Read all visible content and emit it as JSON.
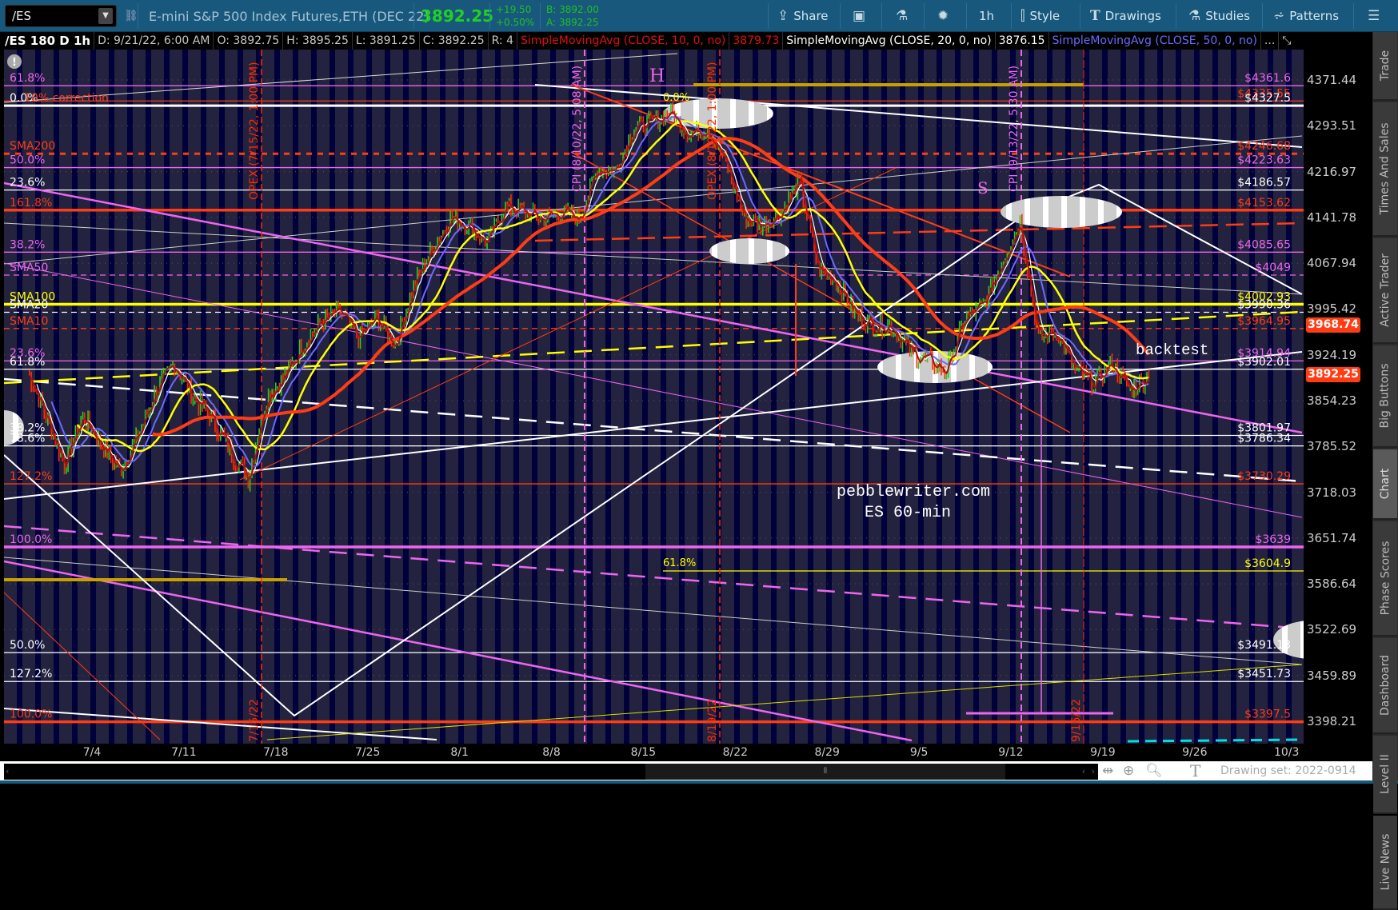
{
  "toolbar": {
    "symbol": "/ES",
    "description": "E-mini S&P 500 Index Futures,ETH (DEC 22)",
    "last": "3892.25",
    "change": "+19.50",
    "change_pct": "+0.50%",
    "bid": "B: 3892.00",
    "ask": "A: 3892.25",
    "share": "Share",
    "interval": "1h",
    "style": "Style",
    "drawings": "Drawings",
    "studies": "Studies",
    "patterns": "Patterns"
  },
  "infobar": {
    "chart": "/ES 180 D 1h",
    "date": "D: 9/21/22, 6:00 AM",
    "open": "O: 3892.75",
    "high": "H: 3895.25",
    "low": "L: 3891.25",
    "close": "C: 3892.25",
    "range": "R: 4",
    "sma10": "SimpleMovingAvg (CLOSE, 10, 0, no)",
    "sma10_val": "3879.73",
    "sma20": "SimpleMovingAvg (CLOSE, 20, 0, no)",
    "sma20_val": "3876.15",
    "sma50": "SimpleMovingAvg (CLOSE, 50, 0, no)",
    "more": "..."
  },
  "price_tags": {
    "sma_tag": "3968.74",
    "last_tag": "3892.25"
  },
  "annotations": {
    "h": "H",
    "s": "S",
    "backtest": "backtest",
    "watermark1": "pebblewriter.com",
    "watermark2": "ES 60-min",
    "fib_top": "0.0%",
    "fib_618": "61.8%",
    "opex1": "OPEX (7/15/22, 1:00 PM)",
    "cpi1": "CPI (8/10/22, 5:08 AM)",
    "opex2": "OPEX (8/19/22, 1:00 PM)",
    "cpi2": "CPI (9/13/22, 5:30 AM)",
    "opex1_short": "7/15/22",
    "opex2_short": "8/19/22",
    "opex3_short": "9/16/22"
  },
  "sidebar": [
    "Trade",
    "Times And Sales",
    "Active Trader",
    "Big Buttons",
    "Chart",
    "Phase Scores",
    "Dashboard",
    "Level II",
    "Live News"
  ],
  "bottom": {
    "drawing_set": "Drawing set: 2022-0914"
  },
  "colors": {
    "toolbar": "#17587c",
    "up": "#22d022",
    "down": "#ff2a00",
    "magenta": "#ee66ee",
    "red": "#ff3c14",
    "yellow": "#ffff00"
  },
  "chart_data": {
    "type": "line",
    "title": "/ES 180 D 1h",
    "scale": "log",
    "ylim": [
      3380,
      4390
    ],
    "y_ticks": [
      "4371.44",
      "4293.51",
      "4216.97",
      "4141.78",
      "4067.94",
      "3995.42",
      "3924.19",
      "3854.23",
      "3785.52",
      "3718.03",
      "3651.74",
      "3586.64",
      "3522.69",
      "3459.89",
      "3398.21"
    ],
    "x_ticks": [
      "7/4",
      "7/11",
      "7/18",
      "7/25",
      "8/1",
      "8/8",
      "8/15",
      "8/22",
      "8/29",
      "9/5",
      "9/12",
      "9/19",
      "9/26",
      "10/3"
    ],
    "series": [
      {
        "name": "/ES close (approx.)",
        "points": [
          [
            "6/28",
            3900
          ],
          [
            "6/29",
            3830
          ],
          [
            "6/30",
            3760
          ],
          [
            "7/1",
            3830
          ],
          [
            "7/5",
            3750
          ],
          [
            "7/6",
            3800
          ],
          [
            "7/7",
            3870
          ],
          [
            "7/8",
            3910
          ],
          [
            "7/11",
            3860
          ],
          [
            "7/12",
            3830
          ],
          [
            "7/13",
            3780
          ],
          [
            "7/14",
            3740
          ],
          [
            "7/15",
            3860
          ],
          [
            "7/18",
            3890
          ],
          [
            "7/19",
            3940
          ],
          [
            "7/20",
            3975
          ],
          [
            "7/21",
            3990
          ],
          [
            "7/22",
            3950
          ],
          [
            "7/25",
            3980
          ],
          [
            "7/26",
            3940
          ],
          [
            "7/27",
            4030
          ],
          [
            "7/28",
            4090
          ],
          [
            "7/29",
            4140
          ],
          [
            "8/1",
            4130
          ],
          [
            "8/2",
            4100
          ],
          [
            "8/3",
            4160
          ],
          [
            "8/4",
            4150
          ],
          [
            "8/5",
            4140
          ],
          [
            "8/8",
            4150
          ],
          [
            "8/9",
            4140
          ],
          [
            "8/10",
            4220
          ],
          [
            "8/11",
            4220
          ],
          [
            "8/12",
            4290
          ],
          [
            "8/15",
            4300
          ],
          [
            "8/16",
            4315
          ],
          [
            "8/17",
            4280
          ],
          [
            "8/18",
            4290
          ],
          [
            "8/19",
            4230
          ],
          [
            "8/22",
            4140
          ],
          [
            "8/23",
            4130
          ],
          [
            "8/24",
            4150
          ],
          [
            "8/25",
            4200
          ],
          [
            "8/26",
            4060
          ],
          [
            "8/29",
            4040
          ],
          [
            "8/30",
            3990
          ],
          [
            "8/31",
            3970
          ],
          [
            "9/1",
            3970
          ],
          [
            "9/2",
            3930
          ],
          [
            "9/6",
            3900
          ],
          [
            "9/7",
            3980
          ],
          [
            "9/8",
            4000
          ],
          [
            "9/9",
            4070
          ],
          [
            "9/12",
            4135
          ],
          [
            "9/13",
            3950
          ],
          [
            "9/14",
            3960
          ],
          [
            "9/15",
            3900
          ],
          [
            "9/16",
            3880
          ],
          [
            "9/19",
            3910
          ],
          [
            "9/20",
            3870
          ],
          [
            "9/21",
            3892.25
          ]
        ]
      }
    ],
    "studies": [
      {
        "name": "SMA10",
        "color": "#ffffff",
        "period": 10
      },
      {
        "name": "SMA20",
        "color": "#6a6aff",
        "period": 20
      },
      {
        "name": "SMA50",
        "color": "#ffff00",
        "period": 50
      },
      {
        "name": "SMA200",
        "color": "#ff3c14",
        "period": 200
      }
    ],
    "levels": [
      {
        "price": 4361.6,
        "color": "#ee66ee",
        "style": "solid",
        "right": "$4361.6",
        "left": "61.8%"
      },
      {
        "price": 4335.55,
        "color": "#ff3c14",
        "style": "solid",
        "right": "$4335.55",
        "left": ""
      },
      {
        "price": 4327.5,
        "color": "#ffffff",
        "style": "double",
        "right": "$4327.5",
        "left": "0.0%",
        "left2": "10% correction",
        "left2_color": "#ff3c14"
      },
      {
        "price": 4246.68,
        "color": "#ff3c14",
        "style": "dotted",
        "right": "$4246.68",
        "left": "SMA200"
      },
      {
        "price": 4223.63,
        "color": "#ee66ee",
        "style": "solid",
        "right": "$4223.63",
        "left": "50.0%"
      },
      {
        "price": 4186.57,
        "color": "#ffffff",
        "style": "solid",
        "right": "$4186.57",
        "left": "23.6%"
      },
      {
        "price": 4153.62,
        "color": "#ff3c14",
        "style": "thick",
        "right": "$4153.62",
        "left": "161.8%"
      },
      {
        "price": 4085.65,
        "color": "#ee66ee",
        "style": "solid",
        "right": "$4085.65",
        "left": "38.2%"
      },
      {
        "price": 4049,
        "color": "#ee66ee",
        "style": "dashed",
        "right": "$4049",
        "left": "SMA50"
      },
      {
        "price": 4002.93,
        "color": "#ffff00",
        "style": "thick",
        "right": "$4002.93",
        "left": "SMA100"
      },
      {
        "price": 3990.36,
        "color": "#ffffff",
        "style": "dashed",
        "right": "$3990.36",
        "left": "SMA20"
      },
      {
        "price": 3964.95,
        "color": "#ff3c14",
        "style": "dashed",
        "right": "$3964.95",
        "left": "SMA10"
      },
      {
        "price": 3914.94,
        "color": "#ee66ee",
        "style": "solid",
        "right": "$3914.94",
        "left": "23.6%"
      },
      {
        "price": 3902.01,
        "color": "#ffffff",
        "style": "solid",
        "right": "$3902.01",
        "left": "61.8%"
      },
      {
        "price": 3801.97,
        "color": "#ffffff",
        "style": "solid",
        "right": "$3801.97",
        "left": "38.2%"
      },
      {
        "price": 3786.34,
        "color": "#ffffff",
        "style": "solid",
        "right": "$3786.34",
        "left": "78.6%"
      },
      {
        "price": 3730.29,
        "color": "#ff3c14",
        "style": "solid",
        "right": "$3730.29",
        "left": "127.2%"
      },
      {
        "price": 3639,
        "color": "#ee66ee",
        "style": "thick",
        "right": "$3639",
        "left": "100.0%"
      },
      {
        "price": 3604.9,
        "color": "#ffff00",
        "style": "partial",
        "right": "$3604.9",
        "left": ""
      },
      {
        "price": 3491.13,
        "color": "#ffffff",
        "style": "solid",
        "right": "$3491.13",
        "left": "50.0%"
      },
      {
        "price": 3451.73,
        "color": "#ffffff",
        "style": "solid",
        "right": "$3451.73",
        "left": "127.2%"
      },
      {
        "price": 3397.5,
        "color": "#ff3c14",
        "style": "thick",
        "right": "$3397.5",
        "left": "100.0%"
      }
    ]
  }
}
